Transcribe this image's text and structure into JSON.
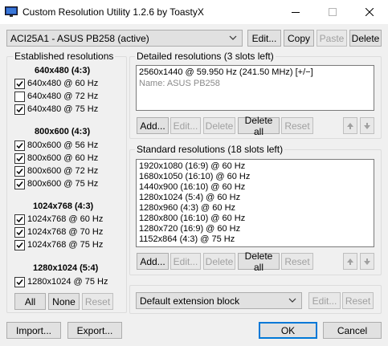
{
  "window": {
    "title": "Custom Resolution Utility 1.2.6 by ToastyX"
  },
  "monitor_select": {
    "value": "ACI25A1 - ASUS PB258 (active)"
  },
  "top_buttons": {
    "edit": "Edit...",
    "copy": "Copy",
    "paste": "Paste",
    "delete": "Delete"
  },
  "established": {
    "title": "Established resolutions",
    "groups": [
      {
        "header": "640x480 (4:3)",
        "items": [
          {
            "label": "640x480 @ 60 Hz",
            "checked": true
          },
          {
            "label": "640x480 @ 72 Hz",
            "checked": false
          },
          {
            "label": "640x480 @ 75 Hz",
            "checked": true
          }
        ]
      },
      {
        "header": "800x600 (4:3)",
        "items": [
          {
            "label": "800x600 @ 56 Hz",
            "checked": true
          },
          {
            "label": "800x600 @ 60 Hz",
            "checked": true
          },
          {
            "label": "800x600 @ 72 Hz",
            "checked": true
          },
          {
            "label": "800x600 @ 75 Hz",
            "checked": true
          }
        ]
      },
      {
        "header": "1024x768 (4:3)",
        "items": [
          {
            "label": "1024x768 @ 60 Hz",
            "checked": true
          },
          {
            "label": "1024x768 @ 70 Hz",
            "checked": true
          },
          {
            "label": "1024x768 @ 75 Hz",
            "checked": true
          }
        ]
      },
      {
        "header": "1280x1024 (5:4)",
        "items": [
          {
            "label": "1280x1024 @ 75 Hz",
            "checked": true
          }
        ]
      }
    ],
    "buttons": {
      "all": "All",
      "none": "None",
      "reset": "Reset"
    }
  },
  "detailed": {
    "title": "Detailed resolutions (3 slots left)",
    "items": [
      "2560x1440 @ 59.950 Hz (241.50 MHz) [+/−]"
    ],
    "name_line": "Name: ASUS PB258",
    "buttons": {
      "add": "Add...",
      "edit": "Edit...",
      "delete": "Delete",
      "delete_all": "Delete all",
      "reset": "Reset"
    }
  },
  "standard": {
    "title": "Standard resolutions (18 slots left)",
    "items": [
      "1920x1080 (16:9) @ 60 Hz",
      "1680x1050 (16:10) @ 60 Hz",
      "1440x900 (16:10) @ 60 Hz",
      "1280x1024 (5:4) @ 60 Hz",
      "1280x960 (4:3) @ 60 Hz",
      "1280x800 (16:10) @ 60 Hz",
      "1280x720 (16:9) @ 60 Hz",
      "1152x864 (4:3) @ 75 Hz"
    ],
    "buttons": {
      "add": "Add...",
      "edit": "Edit...",
      "delete": "Delete",
      "delete_all": "Delete all",
      "reset": "Reset"
    }
  },
  "extension": {
    "select_value": "Default extension block",
    "buttons": {
      "edit": "Edit...",
      "reset": "Reset"
    }
  },
  "bottom": {
    "import": "Import...",
    "export": "Export...",
    "ok": "OK",
    "cancel": "Cancel"
  },
  "colors": {
    "accent": "#0078d7",
    "window_bg": "#f0f0f0",
    "disabled_text": "#a0a0a0"
  }
}
